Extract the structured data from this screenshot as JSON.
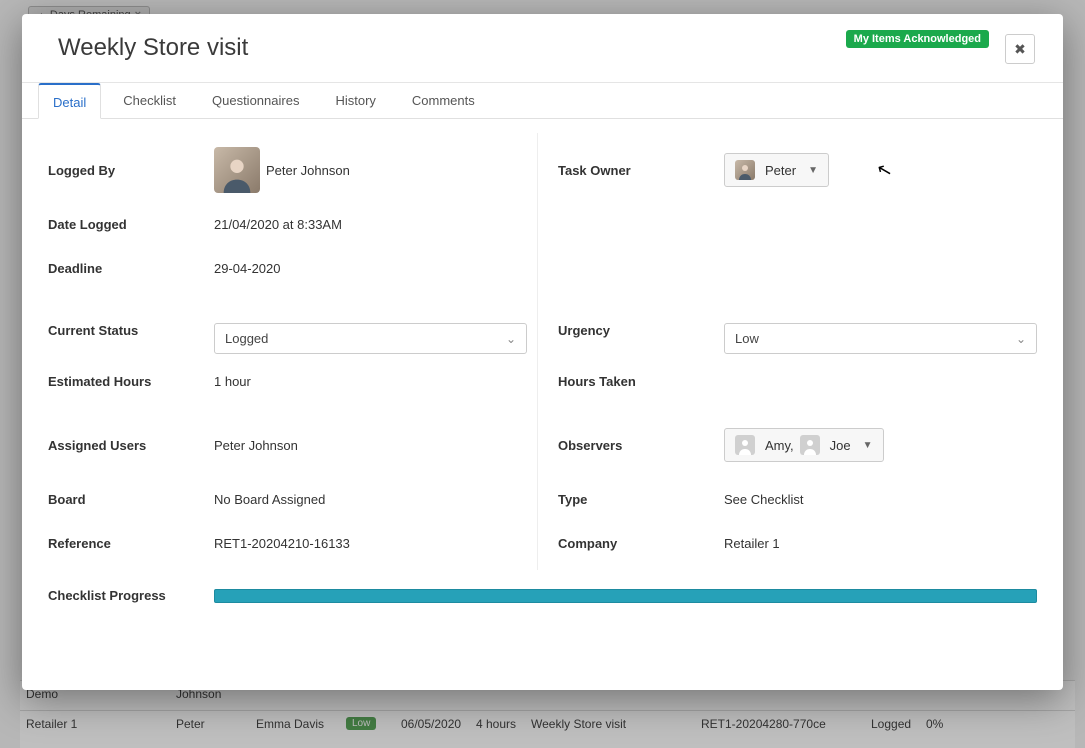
{
  "bg": {
    "tab_label": "Days Remaining",
    "rows": [
      {
        "c1": "Demo",
        "c2": "Johnson",
        "c3": "",
        "low": false,
        "c5": "",
        "c6": "",
        "c7": "",
        "c8": "",
        "c9": "",
        "c10": ""
      },
      {
        "c1": "Retailer 1",
        "c2": "Peter",
        "c3": "Emma Davis",
        "low": true,
        "c5": "06/05/2020",
        "c6": "4 hours",
        "c7": "Weekly Store visit",
        "c8": "RET1-20204280-770ce",
        "c9": "Logged",
        "c10": "0%"
      }
    ]
  },
  "modal": {
    "title": "Weekly Store visit",
    "ack_badge": "My Items Acknowledged"
  },
  "tabs": [
    {
      "label": "Detail",
      "active": true
    },
    {
      "label": "Checklist",
      "active": false
    },
    {
      "label": "Questionnaires",
      "active": false
    },
    {
      "label": "History",
      "active": false
    },
    {
      "label": "Comments",
      "active": false
    }
  ],
  "detail": {
    "logged_by": {
      "label": "Logged By",
      "value": "Peter Johnson"
    },
    "task_owner": {
      "label": "Task Owner",
      "value": "Peter"
    },
    "date_logged": {
      "label": "Date Logged",
      "value": "21/04/2020 at 8:33AM"
    },
    "deadline": {
      "label": "Deadline",
      "value": "29-04-2020"
    },
    "current_status": {
      "label": "Current Status",
      "value": "Logged"
    },
    "urgency": {
      "label": "Urgency",
      "value": "Low"
    },
    "estimated_hours": {
      "label": "Estimated Hours",
      "value": "1 hour"
    },
    "hours_taken": {
      "label": "Hours Taken",
      "value": ""
    },
    "assigned_users": {
      "label": "Assigned Users",
      "value": "Peter Johnson"
    },
    "observers": {
      "label": "Observers",
      "value1": "Amy,",
      "value2": "Joe"
    },
    "board": {
      "label": "Board",
      "value": "No Board Assigned"
    },
    "type": {
      "label": "Type",
      "value": "See Checklist"
    },
    "reference": {
      "label": "Reference",
      "value": "RET1-20204210-16133"
    },
    "company": {
      "label": "Company",
      "value": "Retailer 1"
    },
    "checklist_progress": {
      "label": "Checklist Progress"
    }
  }
}
